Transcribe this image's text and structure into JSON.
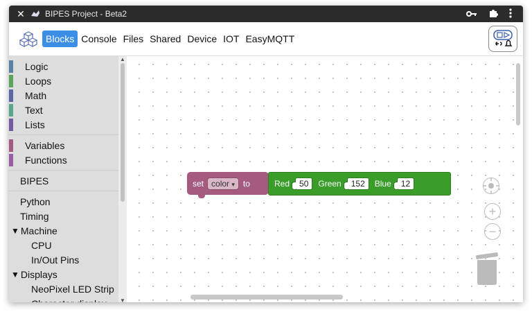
{
  "window": {
    "title": "BIPES Project - Beta2"
  },
  "titlebar": {
    "close_icon": "close-icon",
    "key_icon": "key-icon",
    "extensions_icon": "puzzle-icon",
    "menu_icon": "kebab-menu-icon"
  },
  "navbar": {
    "tabs": [
      {
        "label": "Blocks",
        "active": true
      },
      {
        "label": "Console"
      },
      {
        "label": "Files"
      },
      {
        "label": "Shared"
      },
      {
        "label": "Device"
      },
      {
        "label": "IOT"
      },
      {
        "label": "EasyMQTT"
      }
    ],
    "connect_icon": "connect-icon"
  },
  "toolbox": {
    "categories": [
      {
        "label": "Logic",
        "color": "#5b80a5"
      },
      {
        "label": "Loops",
        "color": "#5ba55b"
      },
      {
        "label": "Math",
        "color": "#5b67a5"
      },
      {
        "label": "Text",
        "color": "#5ba58c"
      },
      {
        "label": "Lists",
        "color": "#745ba5"
      },
      {
        "label": "Variables",
        "color": "#a55b80"
      },
      {
        "label": "Functions",
        "color": "#995ba5"
      },
      {
        "label": "BIPES"
      },
      {
        "label": "Python"
      },
      {
        "label": "Timing"
      },
      {
        "label": "Machine",
        "expander": "▼"
      },
      {
        "label": "CPU"
      },
      {
        "label": "In/Out Pins"
      },
      {
        "label": "Displays",
        "expander": "▼"
      },
      {
        "label": "NeoPixel LED Strip"
      },
      {
        "label": "Character display"
      }
    ]
  },
  "workspace": {
    "set_block": {
      "set": "set",
      "variable": "color",
      "to": "to",
      "color": "#a55b80"
    },
    "color_block": {
      "color": "#3a9d2a",
      "red_label": "Red",
      "red_value": "50",
      "green_label": "Green",
      "green_value": "152",
      "blue_label": "Blue",
      "blue_value": "12"
    },
    "controls": {
      "recenter": "+",
      "zoom_in": "+",
      "zoom_out": "−"
    }
  }
}
